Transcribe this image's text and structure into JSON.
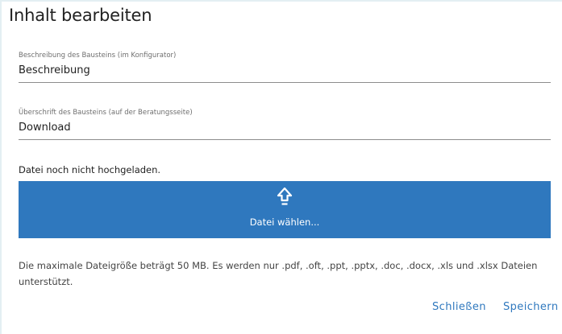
{
  "dialog": {
    "title": "Inhalt bearbeiten"
  },
  "fields": [
    {
      "label": "Beschreibung des Bausteins (im Konfigurator)",
      "value": "Beschreibung"
    },
    {
      "label": "Überschrift des Bausteins (auf der Beratungsseite)",
      "value": "Download"
    }
  ],
  "upload": {
    "status": "Datei noch nicht hochgeladen.",
    "button_label": "Datei wählen...",
    "icon": "upload-arrow-icon",
    "button_color": "#2f78be"
  },
  "info": {
    "text": "Die maximale Dateigröße beträgt 50 MB. Es werden nur .pdf, .oft, .ppt, .pptx, .doc, .docx, .xls und .xlsx Dateien unterstützt."
  },
  "footer": {
    "close_label": "Schließen",
    "save_label": "Speichern",
    "link_color": "#2f78be"
  }
}
